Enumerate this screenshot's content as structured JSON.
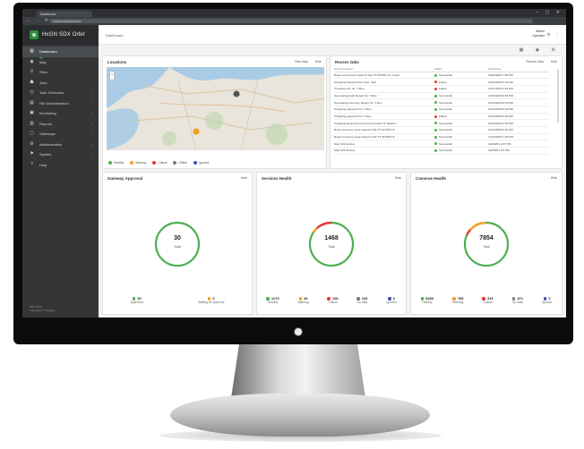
{
  "browser": {
    "tab_title": "Dashboard",
    "url": "localhost/dashboard",
    "nav_arrows": "← → ⟳",
    "window_buttons": "– ▢ ✕"
  },
  "app": {
    "brand": "HxGN SDX Orbit",
    "crumb": "Dashboard",
    "user_name": "Admin",
    "user_role": "Operator",
    "top_icons": "⚙ ⋮",
    "tool_icons": "▦ ◉ ⚙",
    "footer_line1": "SDX Orbit",
    "footer_line2": "Copyright © Hexagon"
  },
  "sidebar": {
    "items": [
      {
        "label": "Dashboard",
        "icon": "▦"
      },
      {
        "label": "Map",
        "icon": "◉"
      },
      {
        "label": "Sites",
        "icon": "⚲"
      },
      {
        "label": "Jobs",
        "icon": "☗"
      },
      {
        "label": "Task Scheduler",
        "icon": "◷"
      },
      {
        "label": "File Administration",
        "icon": "▤"
      },
      {
        "label": "Monitoring",
        "icon": "▣"
      },
      {
        "label": "Reports",
        "icon": "▥"
      },
      {
        "label": "Gateways",
        "icon": "▢"
      },
      {
        "label": "Administration",
        "icon": "⚙"
      },
      {
        "label": "System",
        "icon": "⚑"
      },
      {
        "label": "Help",
        "icon": "?"
      }
    ]
  },
  "locations": {
    "title": "Locations",
    "action1": "View Map",
    "action2": "Hide",
    "zoom": "+\n−",
    "legend": [
      {
        "label": "Healthy",
        "color": "#4caf50"
      },
      {
        "label": "Warning",
        "color": "#f0a020"
      },
      {
        "label": "Critical",
        "color": "#e53935"
      },
      {
        "label": "Offline",
        "color": "#7a7a7a"
      },
      {
        "label": "Ignored",
        "color": "#3f51b5"
      }
    ]
  },
  "jobs": {
    "title": "Recent Jobs",
    "action1": "Recent Jobs",
    "action2": "Hide",
    "columns": [
      "Job Description",
      "Status",
      "Date/Time"
    ],
    "rows": [
      {
        "desc": "Reset event report data for Site TT-SHOW 1S / Local",
        "status": "Successful",
        "color": "#4caf50",
        "time": "10/20/2025 7:56 PM"
      },
      {
        "desc": "Changing Password for User: Test",
        "status": "Failed",
        "color": "#e53935",
        "time": "10/20/2025 5:42 AM"
      },
      {
        "desc": "Creating User for: T-Rex",
        "status": "Failed",
        "color": "#e53935",
        "time": "10/17/2025 3:18 AM"
      },
      {
        "desc": "Generating Audit Report for: T-Rex",
        "status": "Successful",
        "color": "#4caf50",
        "time": "10/13/2025 8:54 PM"
      },
      {
        "desc": "Generating Inventory Report for: T-Rex",
        "status": "Successful",
        "color": "#4caf50",
        "time": "10/13/2025 8:43 PM"
      },
      {
        "desc": "Changing password for: T-Rex",
        "status": "Successful",
        "color": "#4caf50",
        "time": "10/13/2025 8:32 PM"
      },
      {
        "desc": "Changing password for: T-Rex",
        "status": "Failed",
        "color": "#e53935",
        "time": "10/13/2025 8:20 PM"
      },
      {
        "desc": "Changing Environment and Automated for Stations",
        "status": "Successful",
        "color": "#4caf50",
        "time": "10/13/2025 8:20 PM"
      },
      {
        "desc": "Reset inventory report data for Site TT-SHOW 1S",
        "status": "Successful",
        "color": "#4caf50",
        "time": "10/13/2025 8:04 PM"
      },
      {
        "desc": "Reset inventory report data for Site TT-SHOW 1S",
        "status": "Successful",
        "color": "#4caf50",
        "time": "10/13/2025 7:46 PM"
      },
      {
        "desc": "Start VM-Service",
        "status": "Successful",
        "color": "#4caf50",
        "time": "10/2025 12:37 PM"
      },
      {
        "desc": "Start VM-Service",
        "status": "Successful",
        "color": "#4caf50",
        "time": "10/2025 1:07 PM"
      }
    ]
  },
  "gateway": {
    "title": "Gateway Approval",
    "action": "Hide",
    "total": "30",
    "total_label": "Total",
    "stats": [
      {
        "value": "30",
        "label": "Approved",
        "color": "#4caf50"
      },
      {
        "value": "0",
        "label": "Waiting for approval",
        "color": "#f0a020"
      }
    ]
  },
  "services": {
    "title": "Services Health",
    "action": "Hide",
    "total": "1468",
    "total_label": "Total",
    "stats": [
      {
        "value": "1174",
        "label": "Healthy",
        "color": "#4caf50"
      },
      {
        "value": "44",
        "label": "Warning",
        "color": "#f0a020"
      },
      {
        "value": "118",
        "label": "Critical",
        "color": "#e53935"
      },
      {
        "value": "132",
        "label": "No data",
        "color": "#7a7a7a"
      },
      {
        "value": "0",
        "label": "Ignored",
        "color": "#3f51b5"
      }
    ]
  },
  "cameras": {
    "title": "Cameras Health",
    "action": "Hide",
    "total": "7854",
    "total_label": "Total",
    "stats": [
      {
        "value": "6283",
        "label": "Healthy",
        "color": "#4caf50"
      },
      {
        "value": "785",
        "label": "Warning",
        "color": "#f0a020"
      },
      {
        "value": "315",
        "label": "Critical",
        "color": "#e53935"
      },
      {
        "value": "471",
        "label": "No data",
        "color": "#7a7a7a"
      },
      {
        "value": "0",
        "label": "Ignored",
        "color": "#3f51b5"
      }
    ]
  }
}
